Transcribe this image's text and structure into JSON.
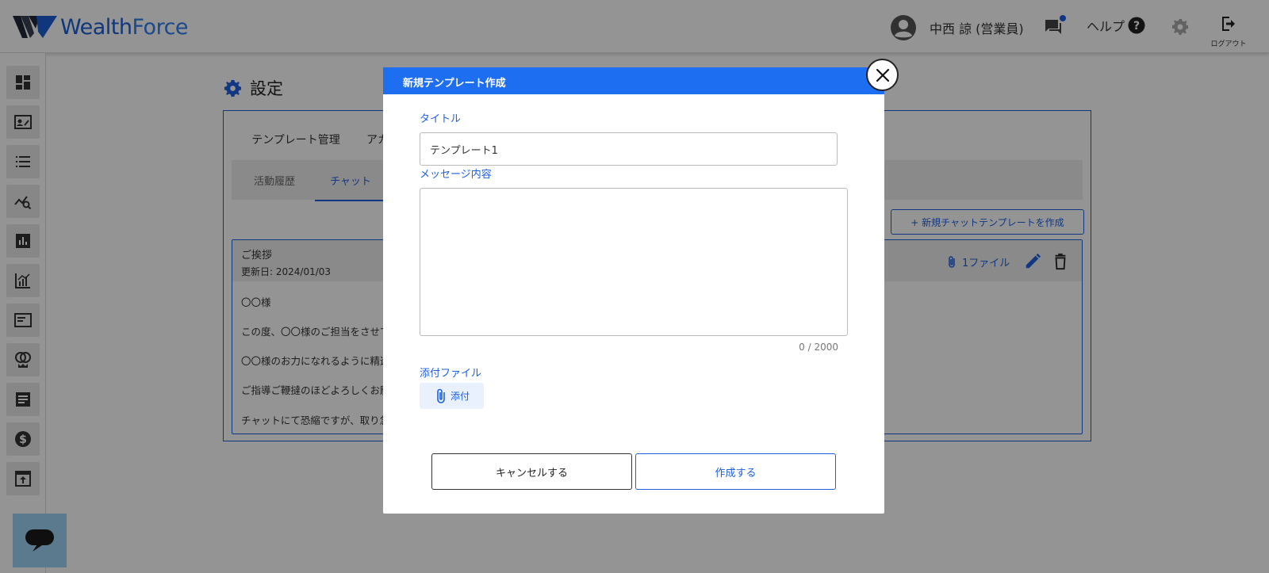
{
  "app": {
    "logo_main": "Wealth",
    "logo_accent": "Force",
    "user_name": "中西 諒 (営業員)",
    "help_label": "ヘルプ",
    "logout_label": "ログアウト"
  },
  "page": {
    "title": "設定",
    "tabs": [
      "テンプレート管理",
      "アカ"
    ],
    "subtabs": [
      "活動履歴",
      "チャット"
    ],
    "new_template_button": "+ 新規チャットテンプレートを作成"
  },
  "template_card": {
    "title": "ご挨拶",
    "updated": "更新日: 2024/01/03",
    "files": "1ファイル",
    "lines": [
      "〇〇様",
      "この度、〇〇様のご担当をさせて",
      "〇〇様のお力になれるように精進",
      "ご指導ご鞭撻のほどよろしくお願",
      "チャットにて恐縮ですが、取り急"
    ]
  },
  "modal": {
    "header": "新規テンプレート作成",
    "title_label": "タイトル",
    "title_value": "テンプレート1",
    "message_label": "メッセージ内容",
    "message_value": "",
    "counter": "0 / 2000",
    "attachment_label": "添付ファイル",
    "attach_button": "添付",
    "cancel_button": "キャンセルする",
    "create_button": "作成する"
  },
  "colors": {
    "primary": "#1e5fe0",
    "modal_header": "#1e6ef2",
    "chat_fab": "#9fd3f5"
  },
  "icons": {
    "sidebar": [
      "dashboard-icon",
      "contact-card-icon",
      "list-icon",
      "analytics-search-icon",
      "bar-chart-icon",
      "growth-chart-icon",
      "window-icon",
      "rings-icon",
      "document-icon",
      "dollar-icon",
      "upload-icon"
    ]
  }
}
